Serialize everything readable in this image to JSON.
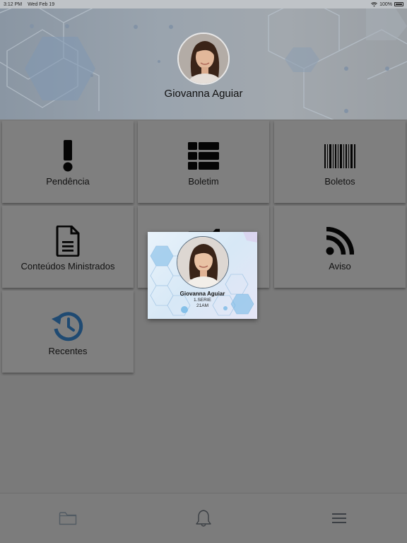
{
  "status_bar": {
    "time": "3:12 PM",
    "date": "Wed Feb 19",
    "battery": "100%"
  },
  "header": {
    "user_name": "Giovanna Aguiar"
  },
  "tiles": [
    {
      "label": "Pendência",
      "icon": "exclamation-icon"
    },
    {
      "label": "Boletim",
      "icon": "table-icon"
    },
    {
      "label": "Boletos",
      "icon": "barcode-icon"
    },
    {
      "label": "Conteúdos Ministrados",
      "icon": "document-icon"
    },
    {
      "label": "",
      "icon": "folder-icon"
    },
    {
      "label": "Aviso",
      "icon": "rss-icon"
    },
    {
      "label": "Recentes",
      "icon": "history-icon"
    }
  ],
  "student_card": {
    "name": "Giovanna Aguiar",
    "grade": "1.SERIE",
    "class": "21AM"
  },
  "bottom_bar": {
    "items": [
      "folder-icon",
      "bell-icon",
      "menu-icon"
    ]
  },
  "colors": {
    "overlay_gray": "#7a7a7a",
    "history_icon_blue": "#1f4a72",
    "card_hex_blue": "#6fb6e6"
  }
}
